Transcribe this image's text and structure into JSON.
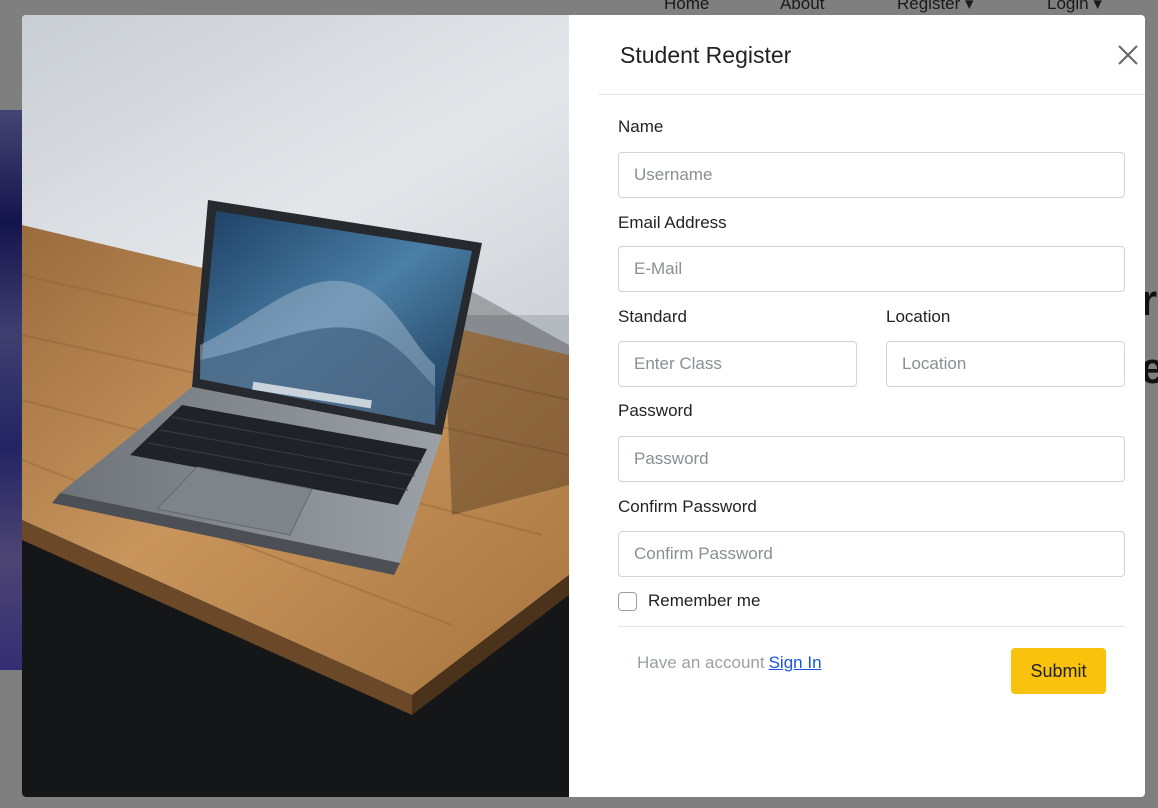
{
  "background": {
    "nav": [
      "Home",
      "About",
      "Register ▾",
      "Login ▾"
    ],
    "headings": [
      "r",
      "e"
    ]
  },
  "modal": {
    "title": "Student Register",
    "fields": {
      "name": {
        "label": "Name",
        "placeholder": "Username"
      },
      "email": {
        "label": "Email Address",
        "placeholder": "E-Mail"
      },
      "standard": {
        "label": "Standard",
        "placeholder": "Enter Class"
      },
      "location": {
        "label": "Location",
        "placeholder": "Location"
      },
      "password": {
        "label": "Password",
        "placeholder": "Password"
      },
      "confirm": {
        "label": "Confirm Password",
        "placeholder": "Confirm Password"
      }
    },
    "remember_label": "Remember me",
    "footer_text": "Have an account",
    "signin_link": "Sign In",
    "submit_label": "Submit"
  },
  "colors": {
    "accent": "#f8c20d",
    "link": "#1a56db",
    "backdrop": "rgba(0,0,0,0.5)"
  },
  "icons": {
    "close": "close-icon"
  }
}
